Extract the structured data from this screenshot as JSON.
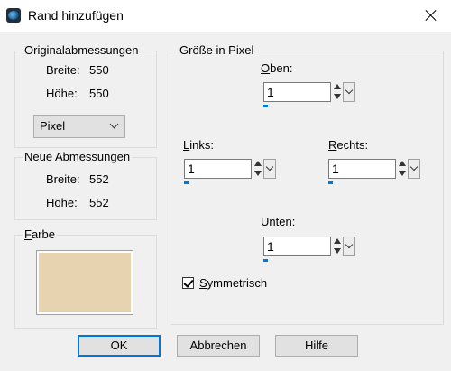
{
  "window": {
    "title": "Rand hinzufügen"
  },
  "original": {
    "title": "Originalabmessungen",
    "width_label": "Breite:",
    "width_value": "550",
    "height_label": "Höhe:",
    "height_value": "550",
    "unit": "Pixel"
  },
  "new": {
    "title": "Neue Abmessungen",
    "width_label": "Breite:",
    "width_value": "552",
    "height_label": "Höhe:",
    "height_value": "552"
  },
  "color": {
    "title_first": "F",
    "title_rest": "arbe",
    "value": "#e8d3b0"
  },
  "size": {
    "title": "Größe in Pixel",
    "top": {
      "label_first": "O",
      "label_rest": "ben:",
      "value": "1",
      "slider_fraction": 0.06
    },
    "left": {
      "label_first": "L",
      "label_rest": "inks:",
      "value": "1",
      "slider_fraction": 0.06
    },
    "right": {
      "label_first": "R",
      "label_rest": "echts:",
      "value": "1",
      "slider_fraction": 0.06
    },
    "bottom": {
      "label_first": "U",
      "label_rest": "nten:",
      "value": "1",
      "slider_fraction": 0.06
    },
    "symmetric": {
      "label_first": "S",
      "label_rest": "ymmetrisch",
      "checked": true
    }
  },
  "buttons": {
    "ok": "OK",
    "cancel": "Abbrechen",
    "help": "Hilfe"
  },
  "colors": {
    "accent": "#0078d7",
    "dialog_bg": "#f0f0f0"
  }
}
